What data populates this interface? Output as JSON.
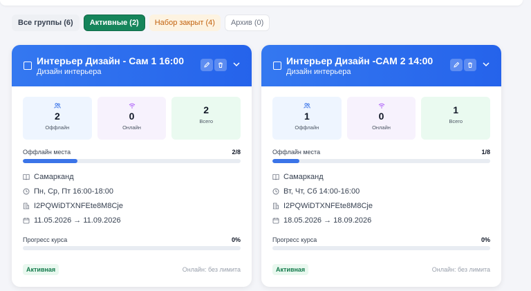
{
  "tabs": [
    {
      "label": "Все группы (6)"
    },
    {
      "label": "Активные (2)"
    },
    {
      "label": "Набор закрыт (4)"
    },
    {
      "label": "Архив (0)"
    }
  ],
  "colors": {
    "header": "#2563eb",
    "active_tab": "#16855b",
    "closed_tab": "#c2610c"
  },
  "cards": [
    {
      "title": "Интерьер Дизайн - Сам 1 16:00",
      "subtitle": "Дизайн интерьера",
      "stats": {
        "offline": {
          "value": "2",
          "label": "Оффлайн"
        },
        "online": {
          "value": "0",
          "label": "Онлайн"
        },
        "total": {
          "value": "2",
          "label": "Всего"
        }
      },
      "seats_label": "Оффлайн места",
      "seats_value": "2/8",
      "seats_fill": 0.25,
      "city": "Самарканд",
      "schedule": "Пн, Ср, Пт 16:00-18:00",
      "code": "I2PQWiDTXNFEte8M8Cje",
      "dates": "11.05.2026 → 11.09.2026",
      "progress_label": "Прогресс курса",
      "progress_value": "0%",
      "progress_fill": 0.0,
      "status": "Активная",
      "online_limit": "Онлайн: без лимита"
    },
    {
      "title": "Интерьер Дизайн -САМ 2 14:00",
      "subtitle": "Дизайн интерьера",
      "stats": {
        "offline": {
          "value": "1",
          "label": "Оффлайн"
        },
        "online": {
          "value": "0",
          "label": "Онлайн"
        },
        "total": {
          "value": "1",
          "label": "Всего"
        }
      },
      "seats_label": "Оффлайн места",
      "seats_value": "1/8",
      "seats_fill": 0.125,
      "city": "Самарканд",
      "schedule": "Вт, Чт, Сб 14:00-16:00",
      "code": "I2PQWiDTXNFEte8M8Cje",
      "dates": "18.05.2026 → 18.09.2026",
      "progress_label": "Прогресс курса",
      "progress_value": "0%",
      "progress_fill": 0.0,
      "status": "Активная",
      "online_limit": "Онлайн: без лимита"
    }
  ]
}
